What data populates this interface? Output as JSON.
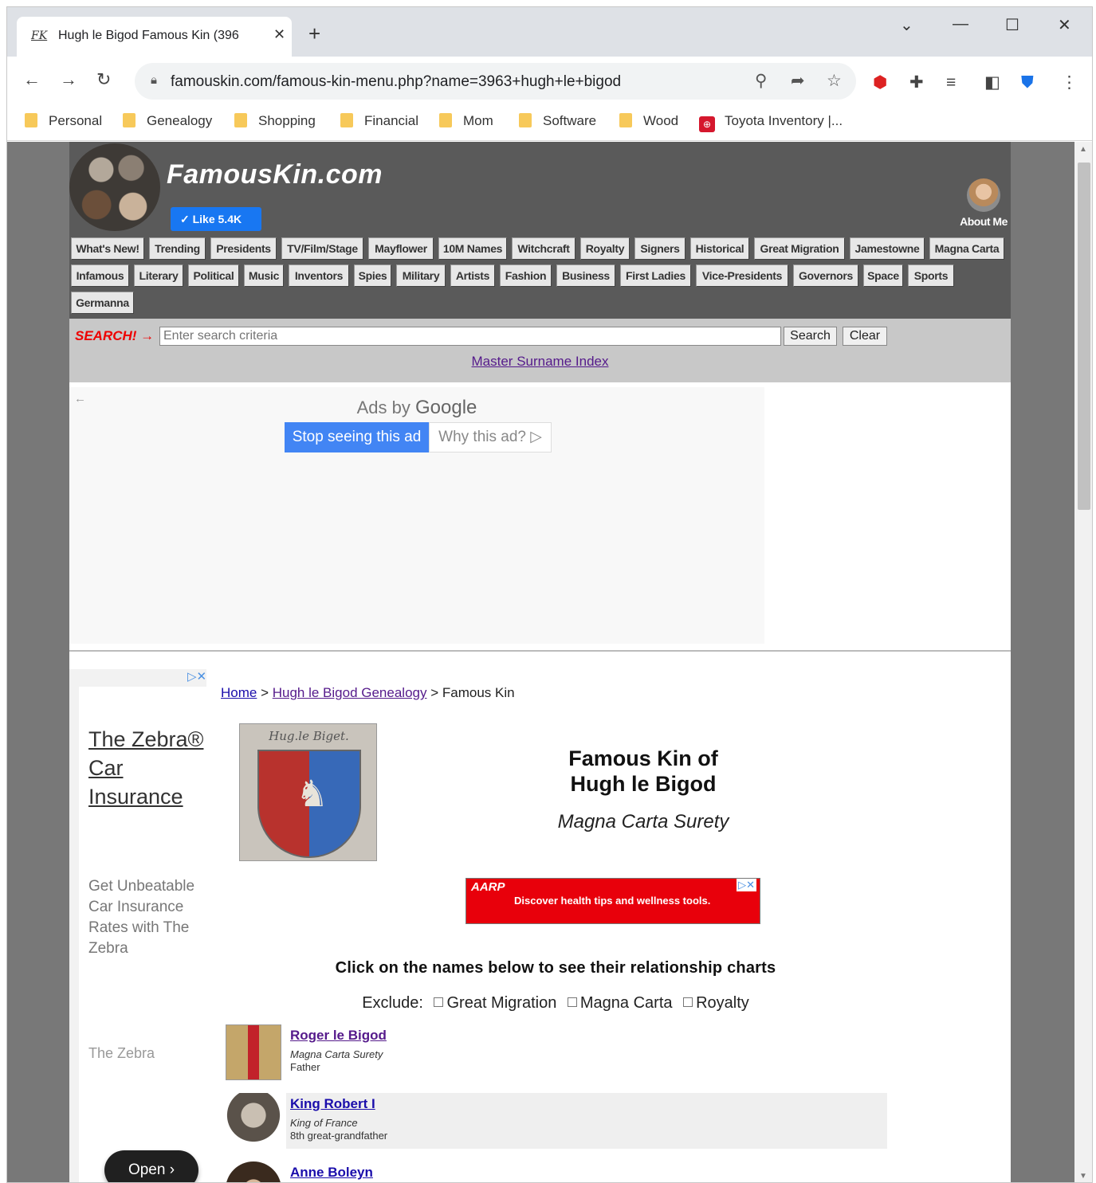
{
  "browser": {
    "tab_title": "Hugh le Bigod Famous Kin (396",
    "tab_favicon": "FK",
    "url": "famouskin.com/famous-kin-menu.php?name=3963+hugh+le+bigod",
    "bookmarks": [
      {
        "label": "Personal",
        "icon": "folder-icon"
      },
      {
        "label": "Genealogy",
        "icon": "folder-icon"
      },
      {
        "label": "Shopping",
        "icon": "folder-icon"
      },
      {
        "label": "Financial",
        "icon": "folder-icon"
      },
      {
        "label": "Mom",
        "icon": "folder-icon"
      },
      {
        "label": "Software",
        "icon": "folder-icon"
      },
      {
        "label": "Wood",
        "icon": "folder-icon"
      },
      {
        "label": "Toyota Inventory |...",
        "icon": "toyota-icon"
      }
    ]
  },
  "site": {
    "logo": "FamousKin.com",
    "like_label": "✓ Like 5.4K",
    "about_label": "About Me",
    "menu_row1": [
      "What's New!",
      "Trending",
      "Presidents",
      "TV/Film/Stage",
      "Mayflower",
      "10M Names",
      "Witchcraft",
      "Royalty",
      "Signers",
      "Historical",
      "Great Migration",
      "Jamestowne",
      "Magna Carta"
    ],
    "menu_row2": [
      "Infamous",
      "Literary",
      "Political",
      "Music",
      "Inventors",
      "Spies",
      "Military",
      "Artists",
      "Fashion",
      "Business",
      "First Ladies",
      "Vice-Presidents",
      "Governors",
      "Space",
      "Sports"
    ],
    "menu_row3": [
      "Germanna"
    ],
    "search": {
      "label": "SEARCH! →",
      "placeholder": "Enter search criteria",
      "search_btn": "Search",
      "clear_btn": "Clear",
      "surname_link": "Master Surname Index"
    }
  },
  "ad": {
    "ads_by": "Ads by",
    "google": "Google",
    "stop_label": "Stop seeing this ad",
    "why_label": "Why this ad? ▷"
  },
  "side_ad": {
    "title": "The Zebra® Car Insurance",
    "body": "Get Unbeatable Car Insurance Rates with The Zebra",
    "brand": "The Zebra",
    "open_label": "Open ›"
  },
  "breadcrumb": {
    "home": "Home",
    "sep": " > ",
    "genealogy": "Hugh le Bigod Genealogy",
    "current": " > Famous Kin"
  },
  "page": {
    "coa_script": "Hug.le Biget.",
    "title_line1": "Famous Kin of",
    "title_line2": "Hugh le Bigod",
    "subtitle": "Magna Carta Surety",
    "aarp_logo": "AARP",
    "aarp_text": "Discover health tips and wellness tools.",
    "click_note": "Click on the names below to see their relationship charts",
    "exclude_label": "Exclude:",
    "exclude_options": [
      "Great Migration",
      "Magna Carta",
      "Royalty"
    ],
    "kin": [
      {
        "name": "Roger le Bigod",
        "title": "Magna Carta Surety",
        "relation": "Father"
      },
      {
        "name": "King Robert I",
        "title": "King of France",
        "relation": "8th great-grandfather"
      },
      {
        "name": "Anne Boleyn",
        "title": "",
        "relation": ""
      }
    ]
  }
}
